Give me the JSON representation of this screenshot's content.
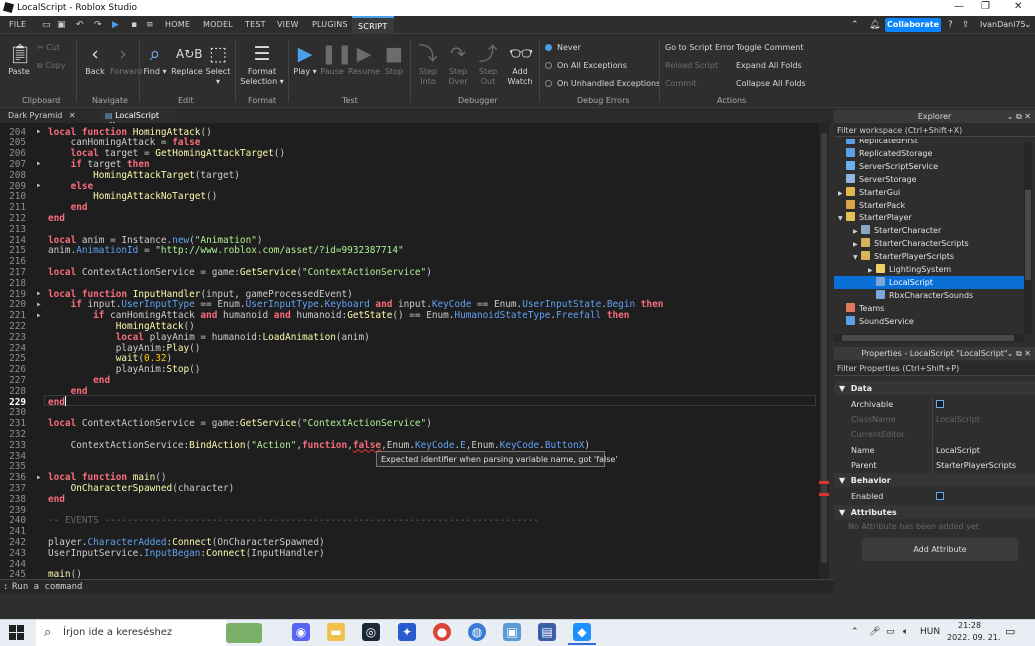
{
  "window": {
    "title": "LocalScript - Roblox Studio"
  },
  "menu": {
    "file": "FILE",
    "tabs": [
      "HOME",
      "MODEL",
      "TEST",
      "VIEW",
      "PLUGINS",
      "SCRIPT"
    ],
    "active_tab": "SCRIPT"
  },
  "topbar": {
    "collaborate": "Collaborate",
    "username": "IvanDani75"
  },
  "ribbon": {
    "clipboard": {
      "paste": "Paste",
      "cut": "Cut",
      "copy": "Copy",
      "group": "Clipboard"
    },
    "navigate": {
      "back": "Back",
      "forward": "Forward",
      "group": "Navigate"
    },
    "edit": {
      "find": "Find",
      "replace": "Replace",
      "select": "Select",
      "group": "Edit"
    },
    "format": {
      "format_selection": "Format Selection",
      "group": "Format"
    },
    "test": {
      "play": "Play",
      "pause": "Pause",
      "resume": "Resume",
      "stop": "Stop",
      "group": "Test"
    },
    "debugger": {
      "step_into": "Step Into",
      "step_over": "Step Over",
      "step_out": "Step Out",
      "add_watch": "Add Watch",
      "group": "Debugger"
    },
    "debug_errors": {
      "never": "Never",
      "on_all": "On All Exceptions",
      "on_unhandled": "On Unhandled Exceptions",
      "group": "Debug Errors"
    },
    "actions": {
      "go_to_error": "Go to Script Error",
      "reload": "Reload Script",
      "commit": "Commit",
      "toggle_comment": "Toggle Comment",
      "expand": "Expand All Folds",
      "collapse": "Collapse All Folds",
      "group": "Actions"
    }
  },
  "doc_tabs": [
    "Dark Pyramid",
    "LocalScript"
  ],
  "editor": {
    "current_line": 229,
    "lines": [
      {
        "n": "204",
        "code": "local function HomingAttack()"
      },
      {
        "n": "205",
        "code": "    canHomingAttack = false"
      },
      {
        "n": "206",
        "code": "    local target = GetHomingAttackTarget()"
      },
      {
        "n": "207",
        "code": "    if target then"
      },
      {
        "n": "208",
        "code": "        HomingAttackTarget(target)"
      },
      {
        "n": "209",
        "code": "    else"
      },
      {
        "n": "210",
        "code": "        HomingAttackNoTarget()"
      },
      {
        "n": "211",
        "code": "    end"
      },
      {
        "n": "212",
        "code": "end"
      },
      {
        "n": "213",
        "code": ""
      },
      {
        "n": "214",
        "code": "local anim = Instance.new(\"Animation\")"
      },
      {
        "n": "215",
        "code": "anim.AnimationId = \"http://www.roblox.com/asset/?id=9932387714\""
      },
      {
        "n": "216",
        "code": ""
      },
      {
        "n": "217",
        "code": "local ContextActionService = game:GetService(\"ContextActionService\")"
      },
      {
        "n": "218",
        "code": ""
      },
      {
        "n": "219",
        "code": "local function InputHandler(input, gameProcessedEvent)"
      },
      {
        "n": "220",
        "code": "    if input.UserInputType == Enum.UserInputType.Keyboard and input.KeyCode == Enum.UserInputState.Begin then"
      },
      {
        "n": "221",
        "code": "        if canHomingAttack and humanoid and humanoid:GetState() == Enum.HumanoidStateType.Freefall then"
      },
      {
        "n": "222",
        "code": "            HomingAttack()"
      },
      {
        "n": "223",
        "code": "            local playAnim = humanoid:LoadAnimation(anim)"
      },
      {
        "n": "224",
        "code": "            playAnim:Play()"
      },
      {
        "n": "225",
        "code": "            wait(0.32)"
      },
      {
        "n": "226",
        "code": "            playAnim:Stop()"
      },
      {
        "n": "227",
        "code": "        end"
      },
      {
        "n": "228",
        "code": "    end"
      },
      {
        "n": "229",
        "code": "end"
      },
      {
        "n": "230",
        "code": ""
      },
      {
        "n": "231",
        "code": "local ContextActionService = game:GetService(\"ContextActionService\")"
      },
      {
        "n": "232",
        "code": ""
      },
      {
        "n": "233",
        "code": "    ContextActionService:BindAction(\"Action\",function,false,Enum.KeyCode.E,Enum.KeyCode.ButtonX)"
      },
      {
        "n": "234",
        "code": ""
      },
      {
        "n": "235",
        "code": ""
      },
      {
        "n": "236",
        "code": "local function main()"
      },
      {
        "n": "237",
        "code": "    OnCharacterSpawned(character)"
      },
      {
        "n": "238",
        "code": "end"
      },
      {
        "n": "239",
        "code": ""
      },
      {
        "n": "240",
        "code": "-- EVENTS -----------------------------------------------------------------------------"
      },
      {
        "n": "241",
        "code": ""
      },
      {
        "n": "242",
        "code": "player.CharacterAdded:Connect(OnCharacterSpawned)"
      },
      {
        "n": "243",
        "code": "UserInputService.InputBegan:Connect(InputHandler)"
      },
      {
        "n": "244",
        "code": ""
      },
      {
        "n": "245",
        "code": "main()"
      }
    ],
    "tooltip": "Expected identifier when parsing variable name, got 'false'"
  },
  "command_bar": {
    "placeholder": "Run a command"
  },
  "explorer": {
    "title": "Explorer",
    "filter": "Filter workspace (Ctrl+Shift+X)",
    "items": [
      {
        "label": "ReplicatedFirst",
        "depth": 0,
        "arrow": "",
        "color": "#5aa0e6"
      },
      {
        "label": "ReplicatedStorage",
        "depth": 0,
        "arrow": "",
        "color": "#5aa0e6"
      },
      {
        "label": "ServerScriptService",
        "depth": 0,
        "arrow": "",
        "color": "#6cb0f0"
      },
      {
        "label": "ServerStorage",
        "depth": 0,
        "arrow": "",
        "color": "#8fb8e0"
      },
      {
        "label": "StarterGui",
        "depth": 0,
        "arrow": "▶",
        "color": "#e0b84a"
      },
      {
        "label": "StarterPack",
        "depth": 0,
        "arrow": "",
        "color": "#d9a44a"
      },
      {
        "label": "StarterPlayer",
        "depth": 0,
        "arrow": "▼",
        "color": "#e3c15a"
      },
      {
        "label": "StarterCharacter",
        "depth": 1,
        "arrow": "▶",
        "color": "#8aa7c4"
      },
      {
        "label": "StarterCharacterScripts",
        "depth": 1,
        "arrow": "▶",
        "color": "#d9b35a"
      },
      {
        "label": "StarterPlayerScripts",
        "depth": 1,
        "arrow": "▼",
        "color": "#d9b35a"
      },
      {
        "label": "LightingSystem",
        "depth": 2,
        "arrow": "▶",
        "color": "#f2d067"
      },
      {
        "label": "LocalScript",
        "depth": 2,
        "arrow": "",
        "color": "#7aa8d8",
        "selected": true
      },
      {
        "label": "RbxCharacterSounds",
        "depth": 2,
        "arrow": "",
        "color": "#7aa8d8"
      },
      {
        "label": "Teams",
        "depth": 0,
        "arrow": "",
        "color": "#e07a5a"
      },
      {
        "label": "SoundService",
        "depth": 0,
        "arrow": "",
        "color": "#5aa0e6"
      }
    ]
  },
  "properties": {
    "title": "Properties - LocalScript \"LocalScript\"",
    "filter": "Filter Properties (Ctrl+Shift+P)",
    "data_section": "Data",
    "rows": [
      {
        "key": "Archivable",
        "value": ""
      },
      {
        "key": "ClassName",
        "value": "LocalScript"
      },
      {
        "key": "CurrentEditor",
        "value": ""
      },
      {
        "key": "Name",
        "value": "LocalScript"
      },
      {
        "key": "Parent",
        "value": "StarterPlayerScripts"
      }
    ],
    "behavior_section": "Behavior",
    "enabled": "Enabled",
    "attributes_section": "Attributes",
    "no_attributes": "No Attribute has been added yet",
    "add_attribute": "Add Attribute"
  },
  "taskbar": {
    "search_placeholder": "Írjon ide a kereséshez",
    "lang": "HUN",
    "time": "21:28",
    "date": "2022. 09. 21."
  }
}
